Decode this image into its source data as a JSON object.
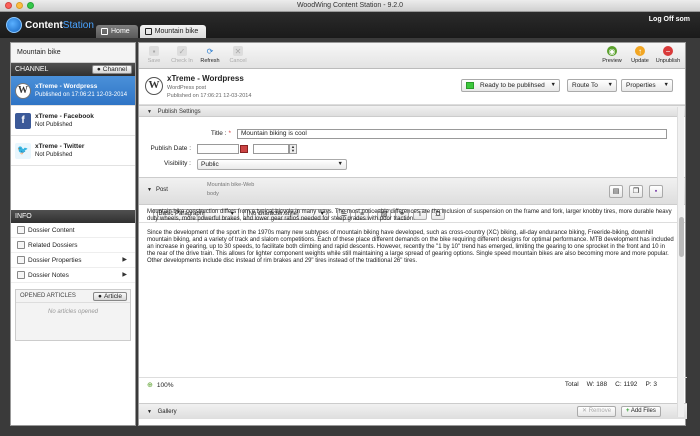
{
  "window": {
    "title": "WoodWing Content Station - 9.2.0"
  },
  "app": {
    "brand_a": "Content",
    "brand_b": "Station",
    "tabs": [
      {
        "label": "Home"
      },
      {
        "label": "Mountain bike"
      }
    ],
    "logoff": "Log Off som"
  },
  "sidebar": {
    "title": "Mountain bike",
    "channel_header": "CHANNEL",
    "channel_button": "Channel",
    "channels": [
      {
        "name": "xTreme - Wordpress",
        "status": "Published on 17:06:21 12-03-2014",
        "icon": "wordpress-icon"
      },
      {
        "name": "xTreme - Facebook",
        "status": "Not Published",
        "icon": "facebook-icon"
      },
      {
        "name": "xTreme - Twitter",
        "status": "Not Published",
        "icon": "twitter-icon"
      }
    ],
    "info_header": "INFO",
    "info_items": [
      {
        "label": "Dossier Content"
      },
      {
        "label": "Related Dossiers"
      },
      {
        "label": "Dossier Properties"
      },
      {
        "label": "Dossier Notes"
      }
    ],
    "opened_title": "OPENED ARTICLES",
    "article_button": "Article",
    "opened_empty": "No articles opened"
  },
  "toolbar": {
    "save": "Save",
    "checkin": "Check In",
    "refresh": "Refresh",
    "cancel": "Cancel",
    "preview": "Preview",
    "update": "Update",
    "unpublish": "Unpublish"
  },
  "doc": {
    "name": "xTreme - Wordpress",
    "type": "WordPress post",
    "published": "Published on 17:06:21 12-03-2014",
    "status": "Ready to be publihsed",
    "status_color": "#3cc83c",
    "route": "Route To",
    "properties": "Properties"
  },
  "publish_settings": {
    "header": "Publish Settings",
    "title_label": "Title :",
    "required_mark": "*",
    "title_value": "Mountain biking is cool",
    "date_label": "Publish Date :",
    "visibility_label": "Visibility :",
    "visibility_value": "Public"
  },
  "post": {
    "header": "Post",
    "path": "Mountain bike-Web",
    "field": "body",
    "paragraph_style": "[Basic Paragraph]",
    "character_style": "[No character style]",
    "paragraphs": [
      "Mountain bike construction differs from a typical bicycle in many ways. The most noticeable differences are the inclusion of suspension on the frame and fork, larger knobby tires, more durable heavy duty wheels, more powerful brakes, and lower gear ratios needed for steep grades with poor traction.",
      "Since the development of the sport in the 1970s many new subtypes of mountain biking have developed, such as cross-country (XC) biking, all-day endurance biking, Freeride-biking, downhill mountain biking, and a variety of track and slalom competitions. Each of these place different demands on the bike requiring different designs for optimal performance. MTB development has included an increase in gearing, up to 30 speeds, to facilitate both climbing and rapid descents. However, recently the \"1 by 10\" trend has emerged, limiting the gearing to one sprocket in the front and 10 in the rear of the drive train. This allows for lighter component weights while still maintaining a large spread of gearing options. Single speed mountain bikes are also becoming more and more popular. Other developments include disc instead of rim brakes and 29\" tires instead of the traditional 26\" tires."
    ],
    "zoom": "100%",
    "total_label": "Total",
    "w": "W: 188",
    "c": "C: 1192",
    "p": "P: 3"
  },
  "gallery": {
    "header": "Gallery",
    "remove": "Remove",
    "add": "Add Files"
  }
}
